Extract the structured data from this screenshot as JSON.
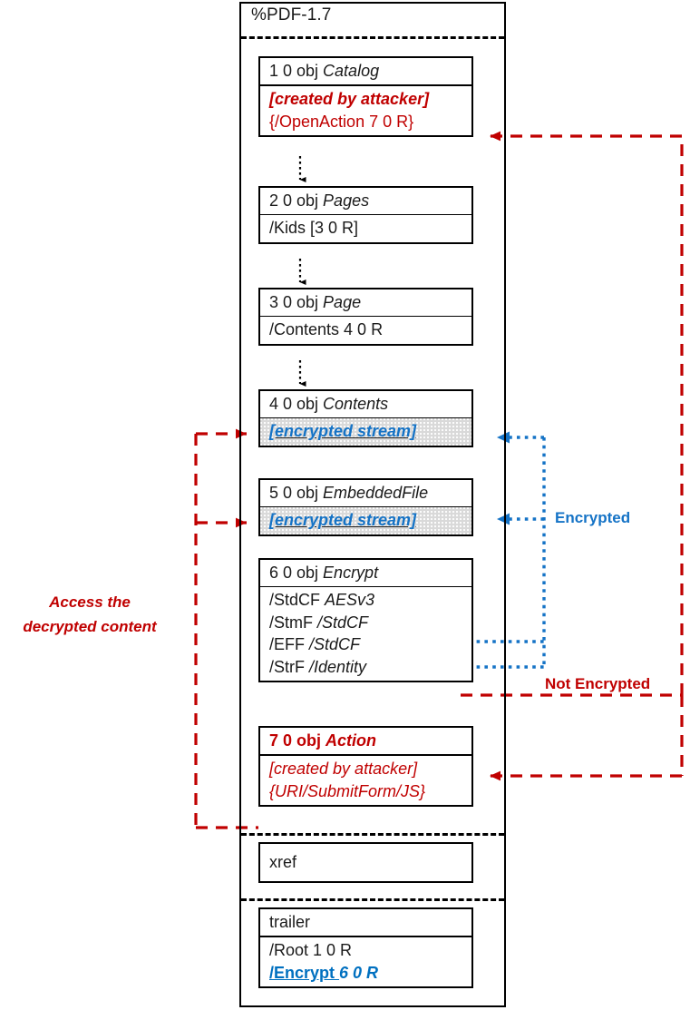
{
  "diagram": {
    "title_line": "%PDF-1.7",
    "colors": {
      "attacker_red": "#C00000",
      "encrypted_blue": "#1573C6",
      "ref_blue": "#0070C0",
      "outline_black": "#000000",
      "stream_fill": "#D9D9D9"
    },
    "objects": [
      {
        "id": "obj1",
        "header": "1 0 obj ",
        "header_type": "Catalog",
        "lines": [
          {
            "text": "[created by attacker]",
            "style": "red-bold-italic"
          },
          {
            "text": "{/OpenAction 7 0 R}",
            "style": "red"
          }
        ]
      },
      {
        "id": "obj2",
        "header": "2 0 obj ",
        "header_type": "Pages",
        "lines": [
          {
            "text": "/Kids [3 0 R]",
            "style": "plain"
          }
        ]
      },
      {
        "id": "obj3",
        "header": "3 0 obj ",
        "header_type": "Page",
        "lines": [
          {
            "text": "/Contents 4 0 R",
            "style": "plain"
          }
        ]
      },
      {
        "id": "obj4",
        "header": "4 0 obj ",
        "header_type": "Contents",
        "lines": [
          {
            "text": "[encrypted stream]",
            "style": "encrypted"
          }
        ]
      },
      {
        "id": "obj5",
        "header": "5 0 obj ",
        "header_type": "EmbeddedFile",
        "lines": [
          {
            "text": "[encrypted stream]",
            "style": "encrypted"
          }
        ]
      },
      {
        "id": "obj6",
        "header": "6 0 obj ",
        "header_type": "Encrypt",
        "lines": [
          {
            "key": "/StdCF ",
            "val": "AESv3"
          },
          {
            "key": "/StmF ",
            "val": "/StdCF"
          },
          {
            "key": "/EFF ",
            "val": "/StdCF"
          },
          {
            "key": "/StrF ",
            "val": "/Identity"
          }
        ]
      },
      {
        "id": "obj7",
        "header": "7 0 obj ",
        "header_type": "Action",
        "lines": [
          {
            "text": "[created by attacker]",
            "style": "red-italic"
          },
          {
            "text": "{URI/SubmitForm/JS}",
            "style": "red-italic"
          }
        ]
      },
      {
        "id": "xref",
        "header": "xref",
        "header_type": "",
        "lines": []
      },
      {
        "id": "trailer",
        "header": "trailer",
        "header_type": "",
        "lines": [
          {
            "key": "/Root ",
            "val": "1 0 R"
          },
          {
            "key": "/Encrypt ",
            "val": "6 0 R"
          }
        ]
      }
    ],
    "annotations": {
      "access_line1": "Access the",
      "access_line2": "decrypted content",
      "encrypted": "Encrypted",
      "not_encrypted": "Not Encrypted"
    }
  }
}
